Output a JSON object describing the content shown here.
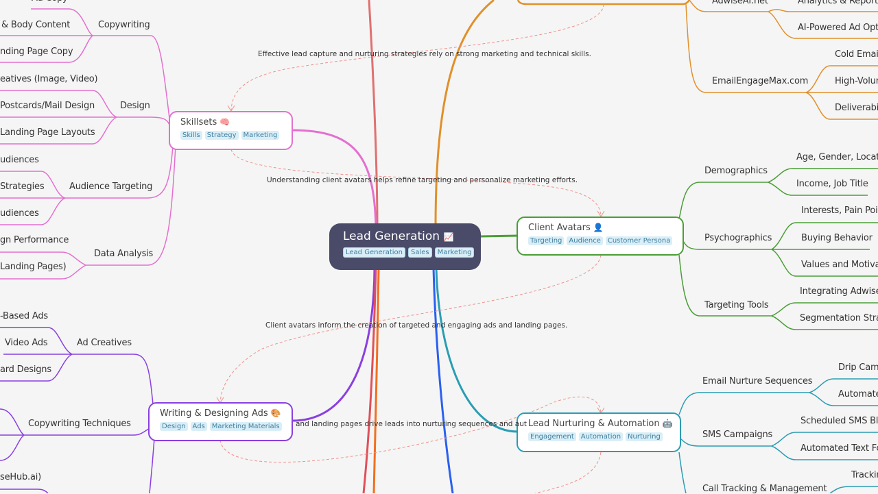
{
  "root": {
    "title": "Lead Generation",
    "icon": "chart-increasing-icon",
    "icon_glyph": "📈",
    "tags": [
      "Lead Generation",
      "Sales",
      "Marketing"
    ]
  },
  "nodes": {
    "skillsets": {
      "title": "Skillsets",
      "icon_glyph": "🧠",
      "tags": [
        "Skills",
        "Strategy",
        "Marketing"
      ],
      "color": "#e46fd0"
    },
    "client_avatars": {
      "title": "Client Avatars",
      "icon_glyph": "👤",
      "tags": [
        "Targeting",
        "Audience",
        "Customer Persona"
      ],
      "color": "#4a9e36"
    },
    "writing_ads": {
      "title": "Writing & Designing Ads",
      "icon_glyph": "🎨",
      "tags": [
        "Design",
        "Ads",
        "Marketing Materials"
      ],
      "color": "#8a3fe0"
    },
    "lead_nurturing": {
      "title": "Lead Nurturing & Automation",
      "icon_glyph": "🤖",
      "tags": [
        "Engagement",
        "Automation",
        "Nurturing"
      ],
      "color": "#2a9db3"
    },
    "tools": {
      "color": "#e0902a"
    }
  },
  "branches": {
    "skillsets": [
      {
        "label": "Copywriting",
        "children": [
          "Ad Copy",
          "& Body Content",
          "nding Page Copy"
        ]
      },
      {
        "label": "Design",
        "children": [
          "eatives (Image, Video)",
          "Postcards/Mail Design",
          "Landing Page Layouts"
        ]
      },
      {
        "label": "Audience Targeting",
        "children": [
          "udiences",
          "Strategies",
          "udiences"
        ]
      },
      {
        "label": "Data Analysis",
        "children": [
          "gn Performance",
          "Landing Pages)"
        ]
      }
    ],
    "client_avatars": [
      {
        "label": "Demographics",
        "children": [
          "Age, Gender, Locatio",
          "Income, Job Title"
        ]
      },
      {
        "label": "Psychographics",
        "children": [
          "Interests, Pain Poin",
          "Buying Behavior",
          "Values and Motivat"
        ]
      },
      {
        "label": "Targeting Tools",
        "children": [
          "Integrating Adwise/",
          "Segmentation Strat"
        ]
      }
    ],
    "tools": [
      {
        "label": "AdwiseAI.net",
        "children": [
          "Analytics & Reportin",
          "AI-Powered Ad Opti"
        ]
      },
      {
        "label": "EmailEngageMax.com",
        "children": [
          "Cold Email",
          "High-Volur",
          "Deliverabil"
        ]
      }
    ],
    "writing_ads": [
      {
        "label": "Ad Creatives",
        "children": [
          "-Based Ads",
          "Video Ads",
          "ard Designs"
        ]
      },
      {
        "label": "Copywriting Techniques",
        "children": []
      },
      {
        "label": "",
        "children": [
          "seHub.ai)"
        ]
      }
    ],
    "lead_nurturing": [
      {
        "label": "Email Nurture Sequences",
        "children": [
          "Drip Camp",
          "Automate"
        ]
      },
      {
        "label": "SMS Campaigns",
        "children": [
          "Scheduled SMS Bla",
          "Automated Text Fol"
        ]
      },
      {
        "label": "Call Tracking & Management",
        "children": [
          "Trackin"
        ]
      }
    ]
  },
  "relations": [
    "Effective lead capture and nurturing strategies rely on strong marketing and technical skills.",
    "Understanding client avatars helps refine targeting and personalize marketing efforts.",
    "Client avatars inform the creation of targeted and engaging ads and landing pages.",
    "and landing pages drive leads into nurturing sequences and aut"
  ]
}
